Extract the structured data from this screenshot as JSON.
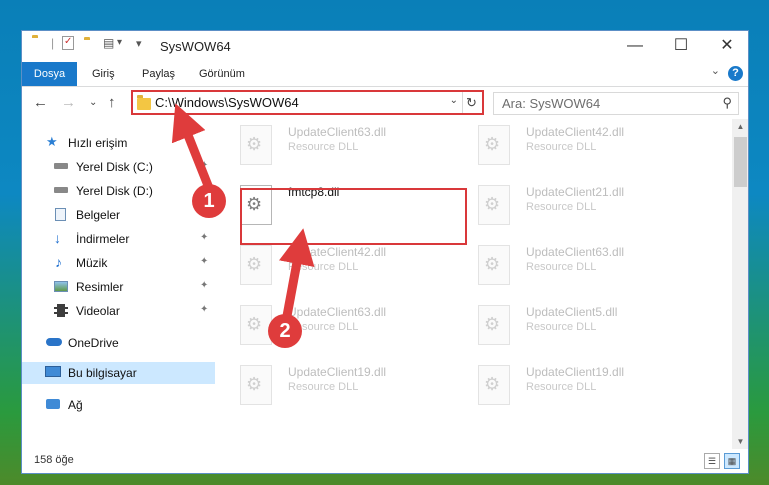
{
  "window": {
    "title": "SysWOW64",
    "minimize_glyph": "—",
    "maximize_glyph": "☐",
    "close_glyph": "✕",
    "quick_access_chevron": "▾"
  },
  "ribbon": {
    "tabs": [
      "Dosya",
      "Giriş",
      "Paylaş",
      "Görünüm"
    ],
    "collapse_glyph": "⌄",
    "help_glyph": "?"
  },
  "nav": {
    "back_glyph": "←",
    "forward_glyph": "→",
    "recent_glyph": "⌄",
    "up_glyph": "↑",
    "address": "C:\\Windows\\SysWOW64",
    "address_chevron": "⌄",
    "refresh_glyph": "↻",
    "search_placeholder": "Ara: SysWOW64",
    "search_icon_glyph": "⚲"
  },
  "sidebar": {
    "pin_glyph": "✦",
    "items": [
      {
        "label": "Hızlı erişim",
        "icon": "star-icon"
      },
      {
        "label": "Yerel Disk (C:)",
        "icon": "drive-icon"
      },
      {
        "label": "Yerel Disk (D:)",
        "icon": "drive-icon"
      },
      {
        "label": "Belgeler",
        "icon": "documents-icon"
      },
      {
        "label": "İndirmeler",
        "icon": "download-icon"
      },
      {
        "label": "Müzik",
        "icon": "music-icon"
      },
      {
        "label": "Resimler",
        "icon": "pictures-icon"
      },
      {
        "label": "Videolar",
        "icon": "video-icon"
      },
      {
        "label": "OneDrive",
        "icon": "cloud-icon"
      },
      {
        "label": "Bu bilgisayar",
        "icon": "computer-icon"
      },
      {
        "label": "Ağ",
        "icon": "network-icon"
      }
    ]
  },
  "files": {
    "left": [
      {
        "name": "UpdateClient63.dll",
        "desc": "Resource DLL"
      },
      {
        "name": "fmtcp8.dll",
        "desc": ""
      },
      {
        "name": "UpdateClient42.dll",
        "desc": "Resource DLL"
      },
      {
        "name": "UpdateClient63.dll",
        "desc": "Resource DLL"
      },
      {
        "name": "UpdateClient19.dll",
        "desc": "Resource DLL"
      }
    ],
    "right": [
      {
        "name": "UpdateClient42.dll",
        "desc": "Resource DLL"
      },
      {
        "name": "UpdateClient21.dll",
        "desc": "Resource DLL"
      },
      {
        "name": "UpdateClient63.dll",
        "desc": "Resource DLL"
      },
      {
        "name": "UpdateClient5.dll",
        "desc": "Resource DLL"
      },
      {
        "name": "UpdateClient19.dll",
        "desc": "Resource DLL"
      }
    ]
  },
  "scroll": {
    "up_glyph": "▲",
    "down_glyph": "▼"
  },
  "status": {
    "count": "158 öğe",
    "details_view_glyph": "☰",
    "icons_view_glyph": "▦"
  },
  "annotations": {
    "step1": "1",
    "step2": "2",
    "color": "#df3c3c"
  }
}
